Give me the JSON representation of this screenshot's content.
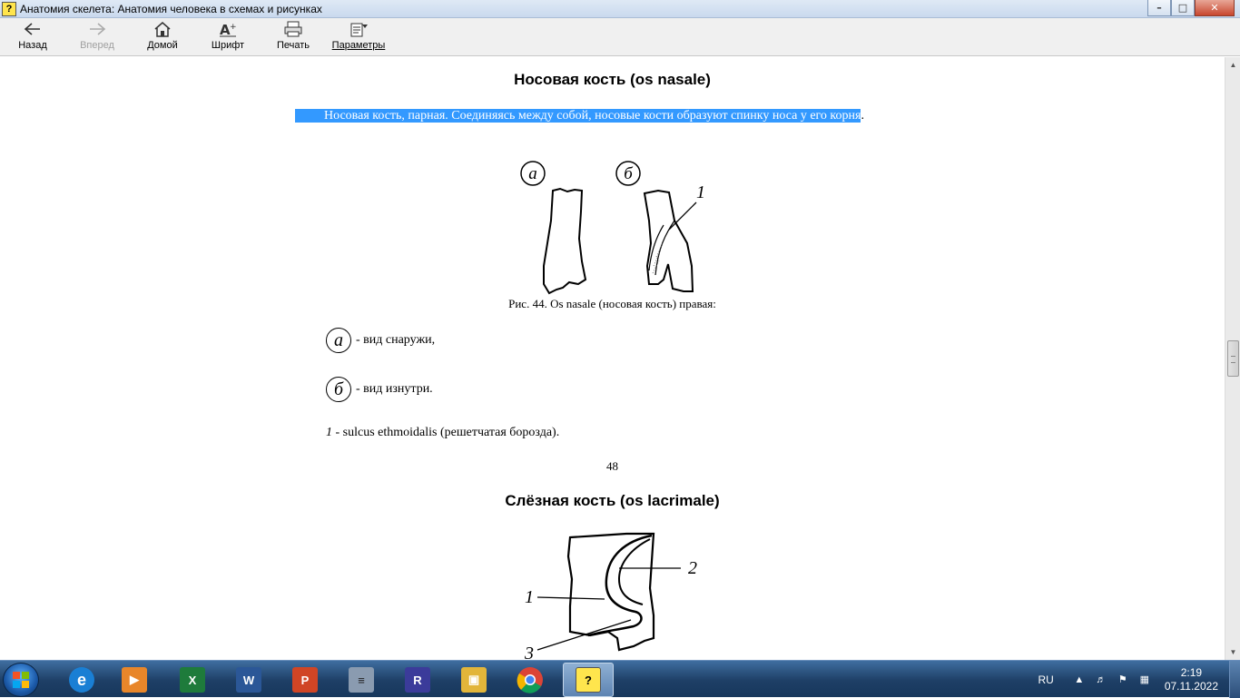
{
  "window": {
    "title": "Анатомия скелета: Анатомия человека в схемах и рисунках",
    "app_icon": "help-icon",
    "buttons": [
      "minimize-icon",
      "maximize-icon",
      "close-icon"
    ]
  },
  "toolbar": {
    "back": "Назад",
    "forward": "Вперед",
    "home": "Домой",
    "font": "Шрифт",
    "print": "Печать",
    "options": "Параметры"
  },
  "content": {
    "section1": {
      "heading": "Носовая кость (os nasale)",
      "paragraph_selected": "Носовая кость, парная. Соединяясь между собой, носовые кости образуют спинку носа у его корня",
      "paragraph_tail": ".",
      "figure_labels": {
        "a": "а",
        "b": "б",
        "one": "1"
      },
      "caption": "Рис. 44. Os nasale (носовая кость) правая:",
      "legend": [
        {
          "symbol": "а",
          "text": "- вид снаружи,"
        },
        {
          "symbol": "б",
          "text": "- вид изнутри."
        }
      ],
      "note_number": "1",
      "note_text": " - sulcus ethmoidalis (решетчатая борозда)."
    },
    "page_number": "48",
    "section2": {
      "heading": "Слёзная кость (os lacrimale)",
      "figure_labels": [
        "1",
        "2",
        "3"
      ]
    }
  },
  "taskbar": {
    "apps": [
      "ie-icon",
      "media-player-icon",
      "excel-icon",
      "word-icon",
      "powerpoint-icon",
      "calculator-icon",
      "winrar-icon",
      "explorer-icon",
      "chrome-icon",
      "help-app-icon"
    ],
    "tray": {
      "language": "RU",
      "time": "2:19",
      "date": "07.11.2022"
    }
  }
}
